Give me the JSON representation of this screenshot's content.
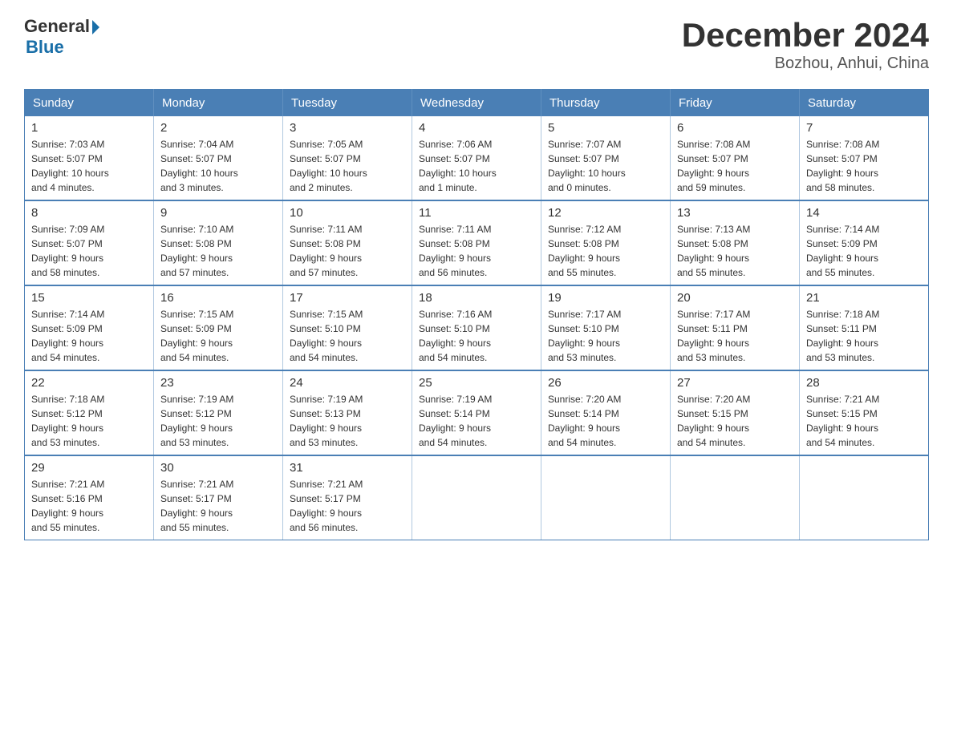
{
  "header": {
    "title": "December 2024",
    "subtitle": "Bozhou, Anhui, China",
    "logo_general": "General",
    "logo_blue": "Blue"
  },
  "days_of_week": [
    "Sunday",
    "Monday",
    "Tuesday",
    "Wednesday",
    "Thursday",
    "Friday",
    "Saturday"
  ],
  "weeks": [
    [
      {
        "day": "1",
        "sunrise": "7:03 AM",
        "sunset": "5:07 PM",
        "daylight": "10 hours and 4 minutes."
      },
      {
        "day": "2",
        "sunrise": "7:04 AM",
        "sunset": "5:07 PM",
        "daylight": "10 hours and 3 minutes."
      },
      {
        "day": "3",
        "sunrise": "7:05 AM",
        "sunset": "5:07 PM",
        "daylight": "10 hours and 2 minutes."
      },
      {
        "day": "4",
        "sunrise": "7:06 AM",
        "sunset": "5:07 PM",
        "daylight": "10 hours and 1 minute."
      },
      {
        "day": "5",
        "sunrise": "7:07 AM",
        "sunset": "5:07 PM",
        "daylight": "10 hours and 0 minutes."
      },
      {
        "day": "6",
        "sunrise": "7:08 AM",
        "sunset": "5:07 PM",
        "daylight": "9 hours and 59 minutes."
      },
      {
        "day": "7",
        "sunrise": "7:08 AM",
        "sunset": "5:07 PM",
        "daylight": "9 hours and 58 minutes."
      }
    ],
    [
      {
        "day": "8",
        "sunrise": "7:09 AM",
        "sunset": "5:07 PM",
        "daylight": "9 hours and 58 minutes."
      },
      {
        "day": "9",
        "sunrise": "7:10 AM",
        "sunset": "5:08 PM",
        "daylight": "9 hours and 57 minutes."
      },
      {
        "day": "10",
        "sunrise": "7:11 AM",
        "sunset": "5:08 PM",
        "daylight": "9 hours and 57 minutes."
      },
      {
        "day": "11",
        "sunrise": "7:11 AM",
        "sunset": "5:08 PM",
        "daylight": "9 hours and 56 minutes."
      },
      {
        "day": "12",
        "sunrise": "7:12 AM",
        "sunset": "5:08 PM",
        "daylight": "9 hours and 55 minutes."
      },
      {
        "day": "13",
        "sunrise": "7:13 AM",
        "sunset": "5:08 PM",
        "daylight": "9 hours and 55 minutes."
      },
      {
        "day": "14",
        "sunrise": "7:14 AM",
        "sunset": "5:09 PM",
        "daylight": "9 hours and 55 minutes."
      }
    ],
    [
      {
        "day": "15",
        "sunrise": "7:14 AM",
        "sunset": "5:09 PM",
        "daylight": "9 hours and 54 minutes."
      },
      {
        "day": "16",
        "sunrise": "7:15 AM",
        "sunset": "5:09 PM",
        "daylight": "9 hours and 54 minutes."
      },
      {
        "day": "17",
        "sunrise": "7:15 AM",
        "sunset": "5:10 PM",
        "daylight": "9 hours and 54 minutes."
      },
      {
        "day": "18",
        "sunrise": "7:16 AM",
        "sunset": "5:10 PM",
        "daylight": "9 hours and 54 minutes."
      },
      {
        "day": "19",
        "sunrise": "7:17 AM",
        "sunset": "5:10 PM",
        "daylight": "9 hours and 53 minutes."
      },
      {
        "day": "20",
        "sunrise": "7:17 AM",
        "sunset": "5:11 PM",
        "daylight": "9 hours and 53 minutes."
      },
      {
        "day": "21",
        "sunrise": "7:18 AM",
        "sunset": "5:11 PM",
        "daylight": "9 hours and 53 minutes."
      }
    ],
    [
      {
        "day": "22",
        "sunrise": "7:18 AM",
        "sunset": "5:12 PM",
        "daylight": "9 hours and 53 minutes."
      },
      {
        "day": "23",
        "sunrise": "7:19 AM",
        "sunset": "5:12 PM",
        "daylight": "9 hours and 53 minutes."
      },
      {
        "day": "24",
        "sunrise": "7:19 AM",
        "sunset": "5:13 PM",
        "daylight": "9 hours and 53 minutes."
      },
      {
        "day": "25",
        "sunrise": "7:19 AM",
        "sunset": "5:14 PM",
        "daylight": "9 hours and 54 minutes."
      },
      {
        "day": "26",
        "sunrise": "7:20 AM",
        "sunset": "5:14 PM",
        "daylight": "9 hours and 54 minutes."
      },
      {
        "day": "27",
        "sunrise": "7:20 AM",
        "sunset": "5:15 PM",
        "daylight": "9 hours and 54 minutes."
      },
      {
        "day": "28",
        "sunrise": "7:21 AM",
        "sunset": "5:15 PM",
        "daylight": "9 hours and 54 minutes."
      }
    ],
    [
      {
        "day": "29",
        "sunrise": "7:21 AM",
        "sunset": "5:16 PM",
        "daylight": "9 hours and 55 minutes."
      },
      {
        "day": "30",
        "sunrise": "7:21 AM",
        "sunset": "5:17 PM",
        "daylight": "9 hours and 55 minutes."
      },
      {
        "day": "31",
        "sunrise": "7:21 AM",
        "sunset": "5:17 PM",
        "daylight": "9 hours and 56 minutes."
      },
      null,
      null,
      null,
      null
    ]
  ],
  "labels": {
    "sunrise": "Sunrise:",
    "sunset": "Sunset:",
    "daylight": "Daylight:"
  }
}
